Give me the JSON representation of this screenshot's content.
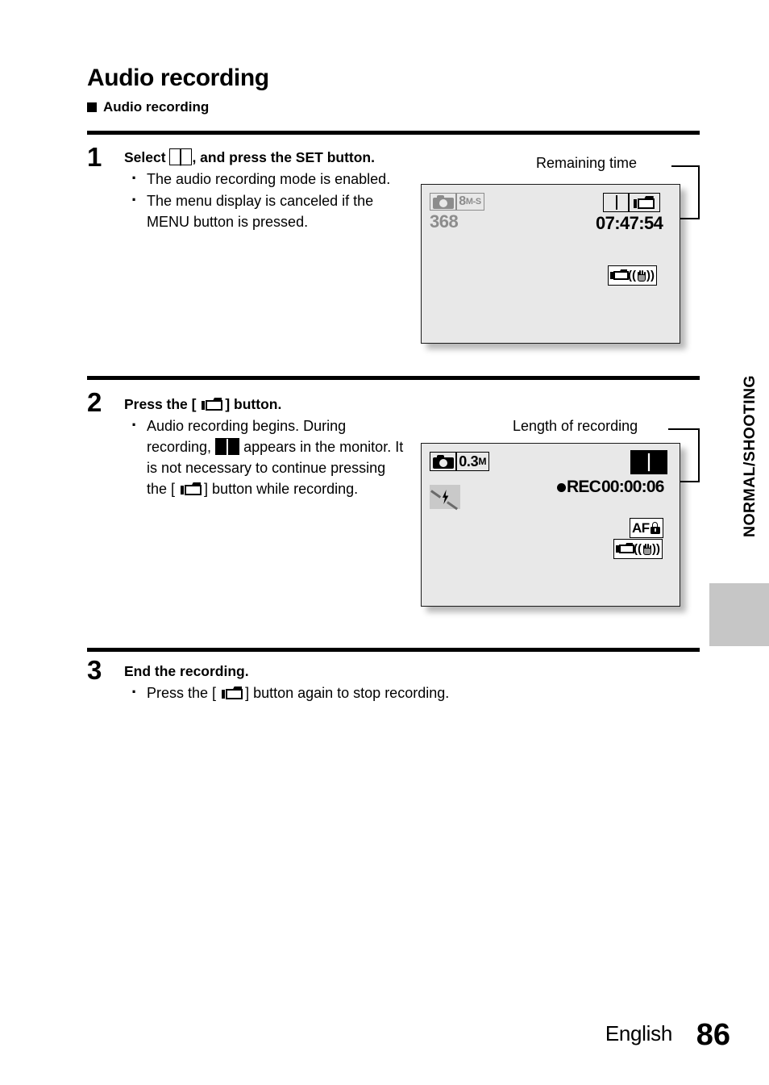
{
  "document": {
    "title": "Audio recording",
    "subhead": "Audio recording",
    "side_tab_label": "NORMAL/SHOOTING",
    "footer": {
      "language": "English",
      "page_number": "86"
    }
  },
  "steps": [
    {
      "number": "1",
      "heading_before_icon": "Select",
      "heading_icon": "microphone-icon",
      "heading_after_icon": ", and press the SET button.",
      "bullets": [
        "The audio recording mode is enabled.",
        "The menu display is canceled if the MENU button is pressed."
      ]
    },
    {
      "number": "2",
      "heading_before_icon": "Press the [",
      "heading_icon": "camcorder-icon",
      "heading_after_icon": "] button.",
      "bullet_parts": {
        "a": "Audio recording begins. During recording,",
        "icon1": "microphone-icon",
        "b": "appears in the monitor. It is not necessary to continue pressing the [",
        "icon2": "camcorder-icon",
        "c": "] button while recording."
      }
    },
    {
      "number": "3",
      "heading": "End the recording.",
      "bullet_parts": {
        "a": "Press the [",
        "icon1": "camcorder-icon",
        "b": "] button again to stop recording."
      }
    }
  ],
  "screens": [
    {
      "id": "lcd-screen-1",
      "callout_label": "Remaining time",
      "osd": {
        "mode_icon": "photo-camera-icon",
        "resolution": "8M-S",
        "resolution_main": "8",
        "resolution_sub": "M-S",
        "shots_remaining": "368",
        "mic_icon": "microphone-icon",
        "camcorder_icon": "camcorder-icon",
        "remaining_time": "07:47:54",
        "stabilizer_icon": "image-stabilizer-icon"
      }
    },
    {
      "id": "lcd-screen-2",
      "callout_label": "Length of recording",
      "osd": {
        "mode_icon": "photo-camera-icon",
        "resolution": "0.3M",
        "resolution_main": "0.3",
        "resolution_sub": "M",
        "flash_icon": "flash-off-icon",
        "mic_icon": "microphone-icon",
        "rec_label": "REC",
        "rec_time": "00:00:06",
        "af_lock_label": "AF",
        "af_lock_icon": "lock-icon",
        "stabilizer_icon": "image-stabilizer-icon"
      }
    }
  ],
  "colors": {
    "lcd_background": "#e8e8e8",
    "lcd_border": "#1a1a1a",
    "side_tab": "#c6c6c6",
    "osd_gray": "#8c8c8c",
    "osd_black": "#000000",
    "flash_badge": "#c9c9c9"
  }
}
